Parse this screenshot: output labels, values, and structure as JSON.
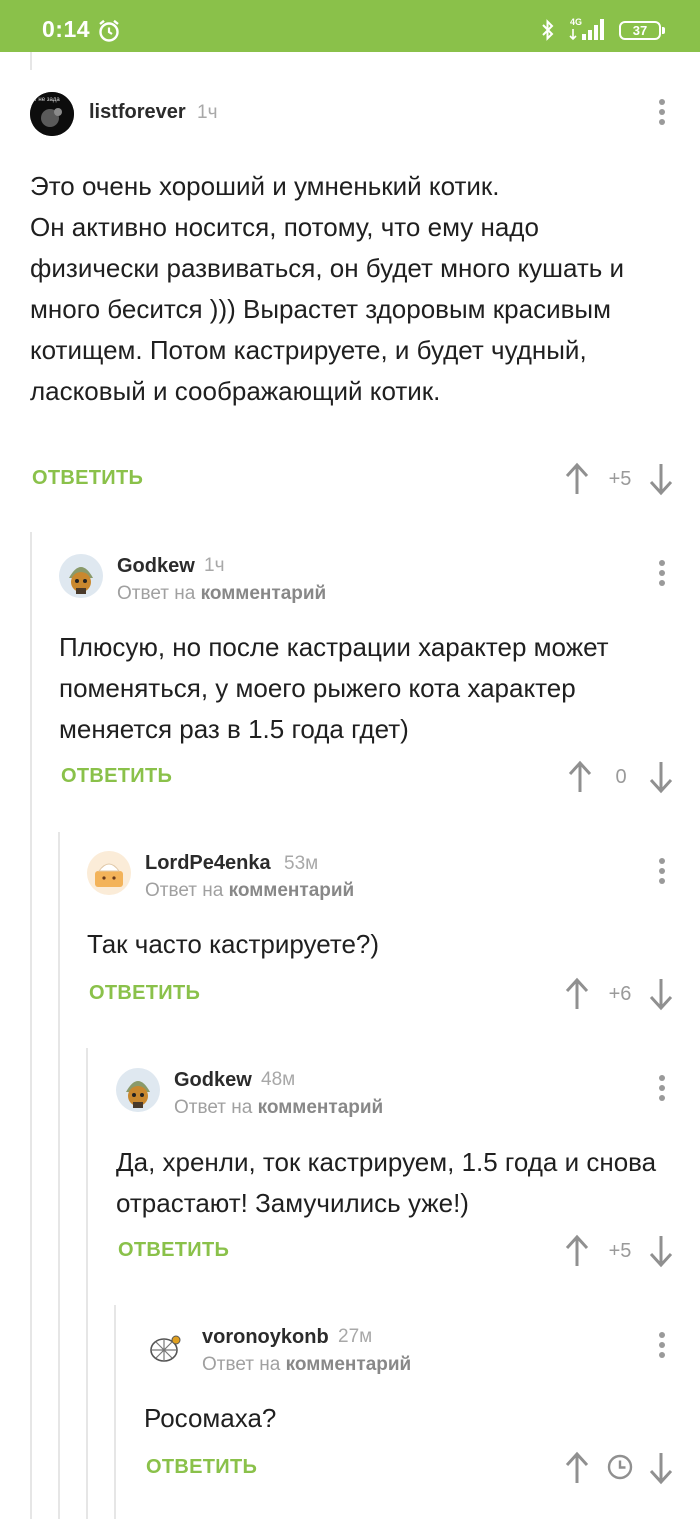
{
  "status_bar": {
    "time": "0:14",
    "network": "4G",
    "battery": "37"
  },
  "comments": [
    {
      "username": "listforever",
      "time": "1ч",
      "avatar_text": "т не зада",
      "reply_prefix": "",
      "reply_target": "",
      "text": "Это очень хороший и умненький котик.\nОн активно носится, потому, что ему надо физически развиваться, он будет много кушать и много бесится ))) Вырастет здоровым красивым котищем. Потом кастрируете, и будет чудный, ласковый и соображающий котик.",
      "reply_label": "ОТВЕТИТЬ",
      "rating": "+5"
    },
    {
      "username": "Godkew",
      "time": "1ч",
      "reply_prefix": "Ответ на",
      "reply_target": "комментарий",
      "text": "Плюсую, но после кастрации характер может поменяться, у моего рыжего кота характер меняется раз в 1.5 года гдет)",
      "reply_label": "ОТВЕТИТЬ",
      "rating": "0"
    },
    {
      "username": "LordPe4enka",
      "time": "53м",
      "reply_prefix": "Ответ на",
      "reply_target": "комментарий",
      "text": "Так часто кастрируете?)",
      "reply_label": "ОТВЕТИТЬ",
      "rating": "+6"
    },
    {
      "username": "Godkew",
      "time": "48м",
      "reply_prefix": "Ответ на",
      "reply_target": "комментарий",
      "text": "Да, хренли, ток кастрируем, 1.5 года и снова отрастают! Замучились уже!)",
      "reply_label": "ОТВЕТИТЬ",
      "rating": "+5"
    },
    {
      "username": "voronoykonb",
      "time": "27м",
      "reply_prefix": "Ответ на",
      "reply_target": "комментарий",
      "text": "Росомаха?",
      "reply_label": "ОТВЕТИТЬ",
      "rating": "",
      "rating_icon": "clock-icon"
    }
  ],
  "colors": {
    "accent": "#8ac14a",
    "status_bar": "#8ac14a",
    "muted": "#a0a0a0"
  }
}
